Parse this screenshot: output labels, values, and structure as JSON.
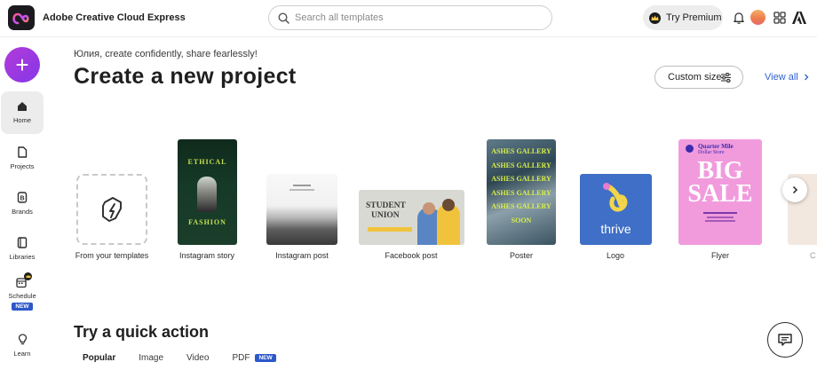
{
  "header": {
    "app_title": "Adobe Creative Cloud Express",
    "search_placeholder": "Search all templates",
    "premium_label": "Try Premium",
    "icons": [
      "bell-icon",
      "avatar",
      "apps-grid-icon",
      "adobe-logo-icon"
    ]
  },
  "sidebar": {
    "create_icon": "+",
    "items": [
      {
        "label": "Home",
        "icon": "home-icon",
        "active": true
      },
      {
        "label": "Projects",
        "icon": "projects-icon"
      },
      {
        "label": "Brands",
        "icon": "brands-icon"
      },
      {
        "label": "Libraries",
        "icon": "libraries-icon"
      },
      {
        "label": "Schedule",
        "icon": "schedule-icon",
        "badge": "NEW"
      },
      {
        "label": "Learn",
        "icon": "learn-icon"
      }
    ]
  },
  "main": {
    "greeting": "Юлия, create confidently, share fearlessly!",
    "title": "Create a new project",
    "custom_size_label": "Custom size",
    "view_all_label": "View all",
    "cards": [
      {
        "label": "From your templates"
      },
      {
        "label": "Instagram story",
        "thumb_text": [
          "ETHICAL",
          "FASHION"
        ]
      },
      {
        "label": "Instagram post"
      },
      {
        "label": "Facebook post",
        "thumb_text": [
          "STUDENT",
          "UNION"
        ]
      },
      {
        "label": "Poster",
        "thumb_text": [
          "ASHES GALLERY",
          "SOON"
        ]
      },
      {
        "label": "Logo",
        "thumb_text": "thrive"
      },
      {
        "label": "Flyer",
        "thumb_text": [
          "Quarter Mile",
          "Dollar Store",
          "BIG",
          "SALE"
        ]
      },
      {
        "label": "C"
      }
    ]
  },
  "quick_actions": {
    "title": "Try a quick action",
    "tabs": [
      {
        "label": "Popular",
        "active": true
      },
      {
        "label": "Image"
      },
      {
        "label": "Video"
      },
      {
        "label": "PDF",
        "badge": "NEW"
      }
    ]
  },
  "colors": {
    "accent_purple": "#9b3ae0",
    "link_blue": "#2f5fcf",
    "badge_blue": "#2d58c9",
    "logo_card_blue": "#3f6fc6",
    "flyer_pink": "#f19bdd"
  }
}
